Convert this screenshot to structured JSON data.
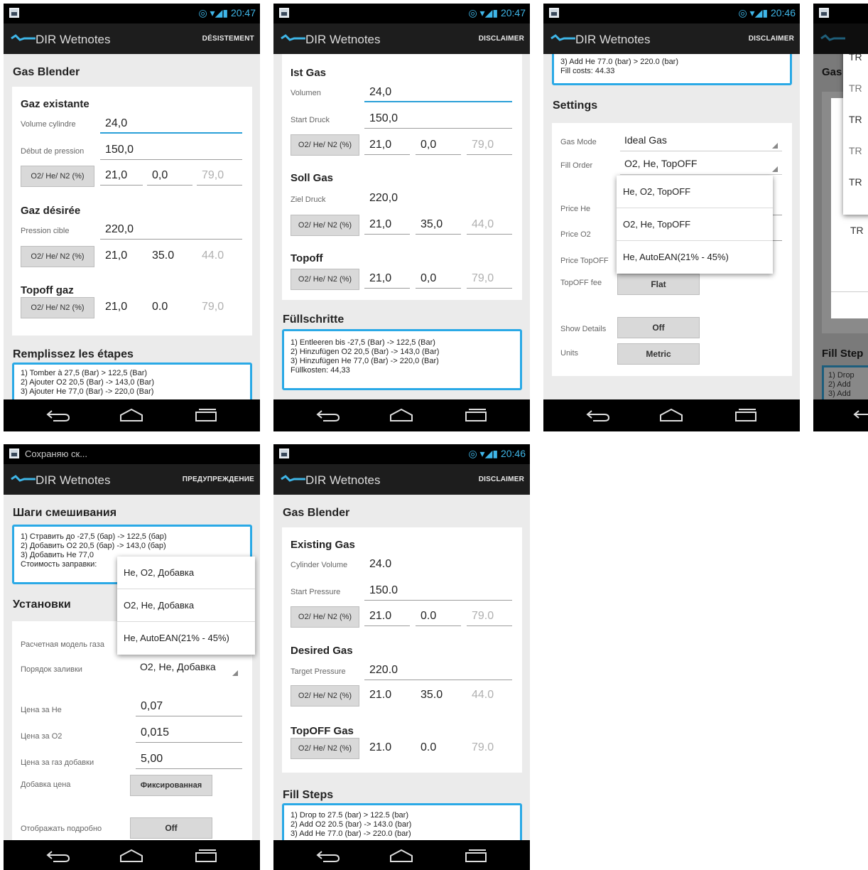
{
  "status": {
    "time1": "20:47",
    "time2": "20:47",
    "time3": "20:46",
    "time6": "20:46",
    "notif5": "Сохраняю ск..."
  },
  "app": {
    "title": "DIR Wetnotes"
  },
  "s1": {
    "action": "DÉSISTEMENT",
    "section_title": "Gas Blender",
    "existing_title": "Gaz existante",
    "vol_label": "Volume cylindre",
    "vol_value": "24,0",
    "press_label": "Début de pression",
    "press_value": "150,0",
    "mix_button": "O2/ He/ N2 (%)",
    "ex_o2": "21,0",
    "ex_he": "0,0",
    "ex_n2": "79,0",
    "desired_title": "Gaz désirée",
    "target_label": "Pression cible",
    "target_value": "220,0",
    "des_o2": "21,0",
    "des_he": "35.0",
    "des_n2": "44.0",
    "topoff_title": "Topoff gaz",
    "top_o2": "21,0",
    "top_he": "0.0",
    "top_n2": "79,0",
    "steps_title": "Remplissez les étapes",
    "steps": [
      "1)  Tomber à  27,5 (Bar)  > 122,5 (Bar)",
      "2)  Ajouter O2 20,5 (Bar) -> 143,0 (Bar)",
      "3)  Ajouter He 77,0 (Bar) -> 220,0 (Bar)"
    ]
  },
  "s2": {
    "action": "DISCLAIMER",
    "first_title": "Ist Gas",
    "vol_label": "Volumen",
    "vol_value": "24,0",
    "start_label": "Start Druck",
    "start_value": "150,0",
    "mix_button": "O2/ He/ N2 (%)",
    "ist_o2": "21,0",
    "ist_he": "0,0",
    "ist_n2": "79,0",
    "soll_title": "Soll Gas",
    "ziel_label": "Ziel Druck",
    "ziel_value": "220,0",
    "soll_o2": "21,0",
    "soll_he": "35,0",
    "soll_n2": "44,0",
    "topoff_title": "Topoff",
    "top_o2": "21,0",
    "top_he": "0,0",
    "top_n2": "79,0",
    "steps_title": "Füllschritte",
    "steps": [
      "1)  Entleeren bis -27,5 (Bar) -> 122,5 (Bar)",
      "2)  Hinzufügen O2 20,5 (Bar) -> 143,0 (Bar)",
      "3)  Hinzufügen He 77,0 (Bar) -> 220,0 (Bar)",
      "Füllkosten: 44,33"
    ]
  },
  "s3": {
    "action": "DISCLAIMER",
    "steps": [
      "3)  Add He 77.0 (bar)  > 220.0 (bar)",
      "Fill costs: 44.33"
    ],
    "settings_title": "Settings",
    "gas_mode_label": "Gas Mode",
    "gas_mode_value": "Ideal Gas",
    "fill_order_label": "Fill Order",
    "fill_order_value": "O2, He, TopOFF",
    "price_he_label": "Price He",
    "price_o2_label": "Price O2",
    "price_topoff_label": "Price TopOFF",
    "topoff_fee_label": "TopOFF fee",
    "topoff_fee_button": "Flat",
    "show_details_label": "Show Details",
    "show_details_button": "Off",
    "units_label": "Units",
    "units_button": "Metric",
    "popup": [
      "He, O2, TopOFF",
      "O2, He, TopOFF",
      "He, AutoEAN(21% - 45%)"
    ]
  },
  "s4": {
    "section_title": "Gas",
    "fill_steps": "Fill Step",
    "dialog_items": [
      "TR",
      "TR",
      "TR",
      "TR",
      "TR",
      "TR"
    ],
    "steps": [
      "1)  Drop",
      "2)  Add",
      "3)  Add"
    ]
  },
  "s5": {
    "action": "ПРЕДУПРЕЖДЕНИЕ",
    "steps_title": "Шаги смешивания",
    "steps": [
      "1)  Стравить до -27,5 (бар) -> 122,5 (бар)",
      "2)  Добавить O2 20,5 (бар) -> 143,0 (бар)",
      "3)  Добавить He 77,0",
      "Стоимость заправки:"
    ],
    "settings_title": "Установки",
    "calc_label": "Расчетная модель газа",
    "order_label": "Порядок заливки",
    "order_value": "O2, He, Добавка",
    "price_he_label": "Цена за He",
    "price_he_value": "0,07",
    "price_o2_label": "Цена за O2",
    "price_o2_value": "0,015",
    "price_top_label": "Цена за газ добавки",
    "price_top_value": "5,00",
    "top_price_label": "Добавка цена",
    "top_price_button": "Фиксированная",
    "details_label": "Отображать подробно",
    "details_button": "Off",
    "popup": [
      "He, O2, Добавка",
      "O2, He, Добавка",
      "He, AutoEAN(21% - 45%)"
    ]
  },
  "s6": {
    "action": "DISCLAIMER",
    "section_title": "Gas Blender",
    "existing_title": "Existing Gas",
    "vol_label": "Cylinder Volume",
    "vol_value": "24.0",
    "start_label": "Start Pressure",
    "start_value": "150.0",
    "mix_button": "O2/ He/ N2 (%)",
    "ex_o2": "21.0",
    "ex_he": "0.0",
    "ex_n2": "79.0",
    "desired_title": "Desired Gas",
    "target_label": "Target Pressure",
    "target_value": "220.0",
    "des_o2": "21.0",
    "des_he": "35.0",
    "des_n2": "44.0",
    "topoff_title": "TopOFF Gas",
    "top_o2": "21.0",
    "top_he": "0.0",
    "top_n2": "79.0",
    "steps_title": "Fill Steps",
    "steps": [
      "1)  Drop to  27.5 (bar)  > 122.5 (bar)",
      "2)  Add O2 20.5 (bar) -> 143.0 (bar)",
      "3)  Add He 77.0 (bar) -> 220.0 (bar)"
    ]
  },
  "colors": {
    "accent": "#2aa9e6",
    "actionbar": "#1d1d1d",
    "background": "#ebebeb",
    "status_text": "#3fb6e8"
  }
}
